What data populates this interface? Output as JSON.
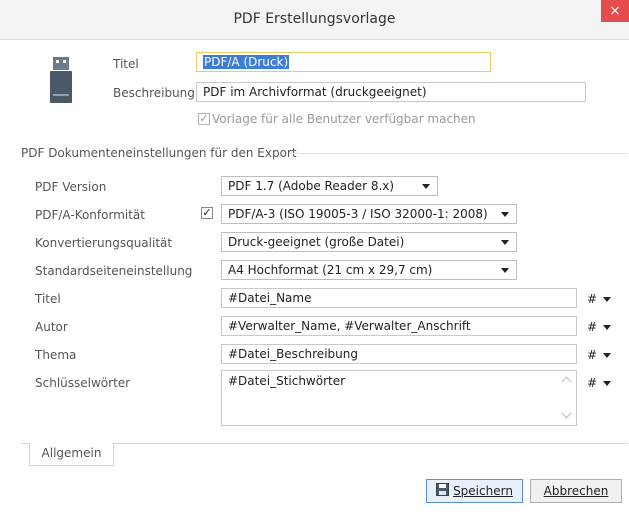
{
  "window": {
    "title": "PDF Erstellungsvorlage",
    "close_glyph": "×"
  },
  "template": {
    "title_label": "Titel",
    "title_value": "PDF/A (Druck)",
    "description_label": "Beschreibung",
    "description_value": "PDF im Archivformat (druckgeeignet)",
    "all_users_label": "Vorlage für alle Benutzer verfügbar machen",
    "all_users_checked": true
  },
  "section": {
    "heading": "PDF Dokumenteneinstellungen für den Export"
  },
  "settings": {
    "version_label": "PDF Version",
    "version_value": "PDF 1.7 (Adobe Reader 8.x)",
    "pdfa_label": "PDF/A-Konformität",
    "pdfa_checked": true,
    "pdfa_value": "PDF/A-3 (ISO 19005-3 / ISO 32000-1: 2008)",
    "quality_label": "Konvertierungsqualität",
    "quality_value": "Druck-geeignet (große Datei)",
    "page_label": "Standardseiteneinstellung",
    "page_value": "A4 Hochformat (21 cm x 29,7 cm)",
    "title_label": "Titel",
    "title_value": "#Datei_Name",
    "author_label": "Autor",
    "author_value": "#Verwalter_Name, #Verwalter_Anschrift",
    "subject_label": "Thema",
    "subject_value": "#Datei_Beschreibung",
    "keywords_label": "Schlüsselwörter",
    "keywords_value": "#Datei_Stichwörter",
    "hash_glyph": "#"
  },
  "tabs": {
    "general": "Allgemein"
  },
  "buttons": {
    "save": "Speichern",
    "cancel": "Abbrechen"
  },
  "icons": {
    "template_icon": "usb-drive-icon",
    "save_icon": "floppy-disk-icon"
  }
}
